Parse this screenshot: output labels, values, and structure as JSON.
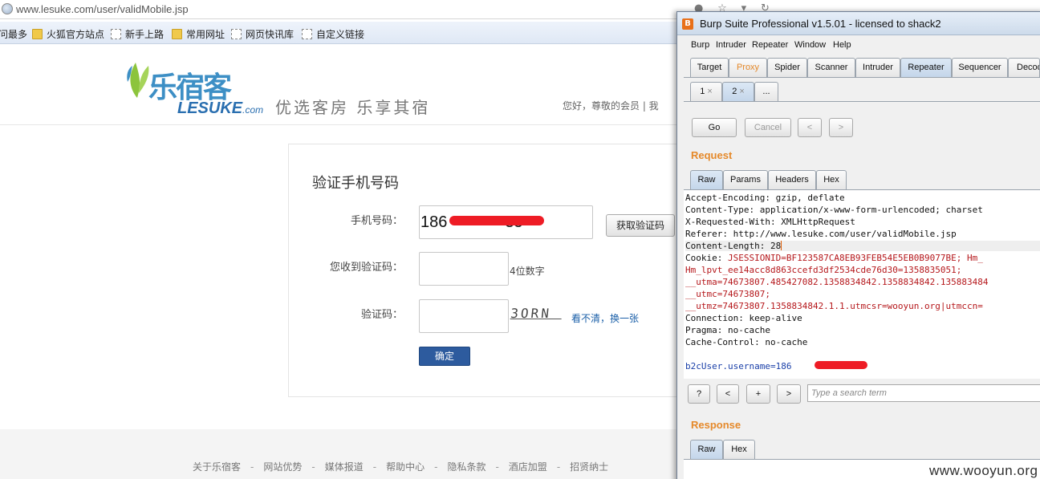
{
  "browser": {
    "url": "www.lesuke.com/user/validMobile.jsp",
    "bookmarks": [
      {
        "label": "问最多",
        "icon": "none"
      },
      {
        "label": "火狐官方站点",
        "icon": "folder-icon"
      },
      {
        "label": "新手上路",
        "icon": "page-icon"
      },
      {
        "label": "常用网址",
        "icon": "folder-icon"
      },
      {
        "label": "网页快讯库",
        "icon": "page-icon"
      },
      {
        "label": "自定义链接",
        "icon": "page-icon"
      }
    ]
  },
  "site": {
    "logo_cn": "乐宿客",
    "logo_en": "LESUKE",
    "logo_domain": ".com",
    "slogan": "优选客房 乐享其宿",
    "greeting": "您好，尊敬的会员 | 我",
    "colors": {
      "brand": "#3d8fc5",
      "leaf": "#8cc43c",
      "confirm": "#2d5b9e",
      "redact": "#ee1c25"
    }
  },
  "form": {
    "title": "验证手机号码",
    "phone_label": "手机号码：",
    "phone_value": "186",
    "phone_tail": "35",
    "get_code_button": "获取验证码",
    "sms_label": "您收到验证码：",
    "sms_hint": "4位数字",
    "captcha_label": "验证码：",
    "captcha_text": "3ORN",
    "captcha_refresh": "看不清，换一张",
    "confirm_button": "确定"
  },
  "footer": {
    "links": [
      "关于乐宿客",
      "网站优势",
      "媒体报道",
      "帮助中心",
      "隐私条款",
      "酒店加盟",
      "招贤纳士"
    ],
    "separator": "-"
  },
  "burp": {
    "title": "Burp Suite Professional v1.5.01 - licensed to shack2",
    "app_icon": "B",
    "menu": [
      "Burp",
      "Intruder",
      "Repeater",
      "Window",
      "Help"
    ],
    "tabs": [
      "Target",
      "Proxy",
      "Spider",
      "Scanner",
      "Intruder",
      "Repeater",
      "Sequencer",
      "Decoder"
    ],
    "active_tab": "Repeater",
    "repeater_tabs": [
      "1",
      "2",
      "..."
    ],
    "tab_close": "×",
    "go_button": "Go",
    "cancel_button": "Cancel",
    "prev_button": "<",
    "next_button": ">",
    "request_label": "Request",
    "request_tabs": [
      "Raw",
      "Params",
      "Headers",
      "Hex"
    ],
    "request_lines": [
      {
        "key": "Accept-Encoding:",
        "val": " gzip, deflate"
      },
      {
        "key": "Content-Type:",
        "val": " application/x-www-form-urlencoded; charset"
      },
      {
        "key": "X-Requested-With:",
        "val": " XMLHttpRequest"
      },
      {
        "key": "Referer:",
        "val": " http://www.lesuke.com/user/validMobile.jsp"
      },
      {
        "key": "Content-Length:",
        "val": " 28"
      },
      {
        "key": "Cookie:",
        "val": " JSESSIONID=BF123587CA8EB93FEB54E5EB0B9077BE; Hm_"
      },
      {
        "key": "",
        "val": "Hm_lpvt_ee14acc8d863ccefd3df2534cde76d30=1358835051;"
      },
      {
        "key": "",
        "val": "__utma=74673807.485427082.1358834842.1358834842.135883484"
      },
      {
        "key": "",
        "val": "__utmc=74673807;"
      },
      {
        "key": "",
        "val": "__utmz=74673807.1358834842.1.1.utmcsr=wooyun.org|utmccn="
      },
      {
        "key": "Connection:",
        "val": " keep-alive"
      },
      {
        "key": "Pragma:",
        "val": " no-cache"
      },
      {
        "key": "Cache-Control:",
        "val": " no-cache"
      },
      {
        "key": "",
        "val": ""
      },
      {
        "key": "",
        "val": "b2cUser.username=186"
      }
    ],
    "search_help": "?",
    "search_prev": "<",
    "search_add": "+",
    "search_next": ">",
    "search_placeholder": "Type a search term",
    "response_label": "Response",
    "response_tabs": [
      "Raw",
      "Hex"
    ]
  },
  "watermark": "www.wooyun.org"
}
